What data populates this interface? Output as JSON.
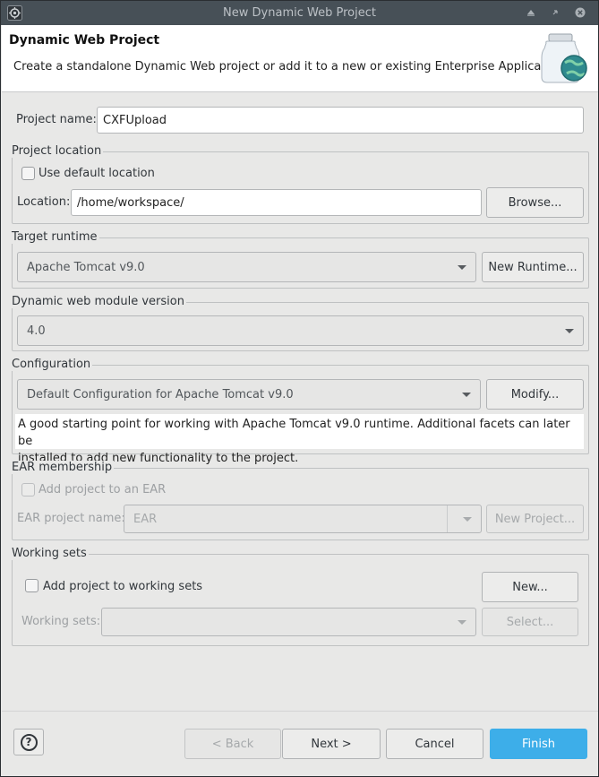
{
  "window": {
    "title": "New Dynamic Web Project"
  },
  "banner": {
    "title": "Dynamic Web Project",
    "description": "Create a standalone Dynamic Web project or add it to a new or existing Enterprise Application."
  },
  "project_name": {
    "label": "Project name:",
    "value": "CXFUpload"
  },
  "location_group": {
    "title": "Project location",
    "use_default_label": "Use default location",
    "use_default_checked": false,
    "location_label": "Location:",
    "location_value": "/home/workspace/",
    "browse_label": "Browse..."
  },
  "runtime_group": {
    "title": "Target runtime",
    "selected": "Apache Tomcat v9.0",
    "new_runtime_label": "New Runtime..."
  },
  "module_group": {
    "title": "Dynamic web module version",
    "selected": "4.0"
  },
  "config_group": {
    "title": "Configuration",
    "selected": "Default Configuration for Apache Tomcat v9.0",
    "modify_label": "Modify...",
    "info_line1": "A good starting point for working with Apache Tomcat v9.0 runtime. Additional facets can later be",
    "info_line2": "installed to add new functionality to the project."
  },
  "ear_group": {
    "title": "EAR membership",
    "add_label": "Add project to an EAR",
    "add_checked": false,
    "name_label": "EAR project name:",
    "name_value": "EAR",
    "new_project_label": "New Project..."
  },
  "working_sets_group": {
    "title": "Working sets",
    "add_label": "Add project to working sets",
    "add_checked": false,
    "new_label": "New...",
    "sets_label": "Working sets:",
    "sets_value": "",
    "select_label": "Select..."
  },
  "footer": {
    "help_label": "?",
    "back_label": "< Back",
    "next_label": "Next >",
    "cancel_label": "Cancel",
    "finish_label": "Finish"
  },
  "colors": {
    "accent": "#3daee9",
    "titlebar": "#475057",
    "window_bg": "#e8e8e7"
  },
  "icons": [
    "app-icon",
    "keep-above-icon",
    "minimize-icon",
    "close-icon",
    "jar-globe-icon",
    "help-icon",
    "dropdown-arrow-icon"
  ]
}
